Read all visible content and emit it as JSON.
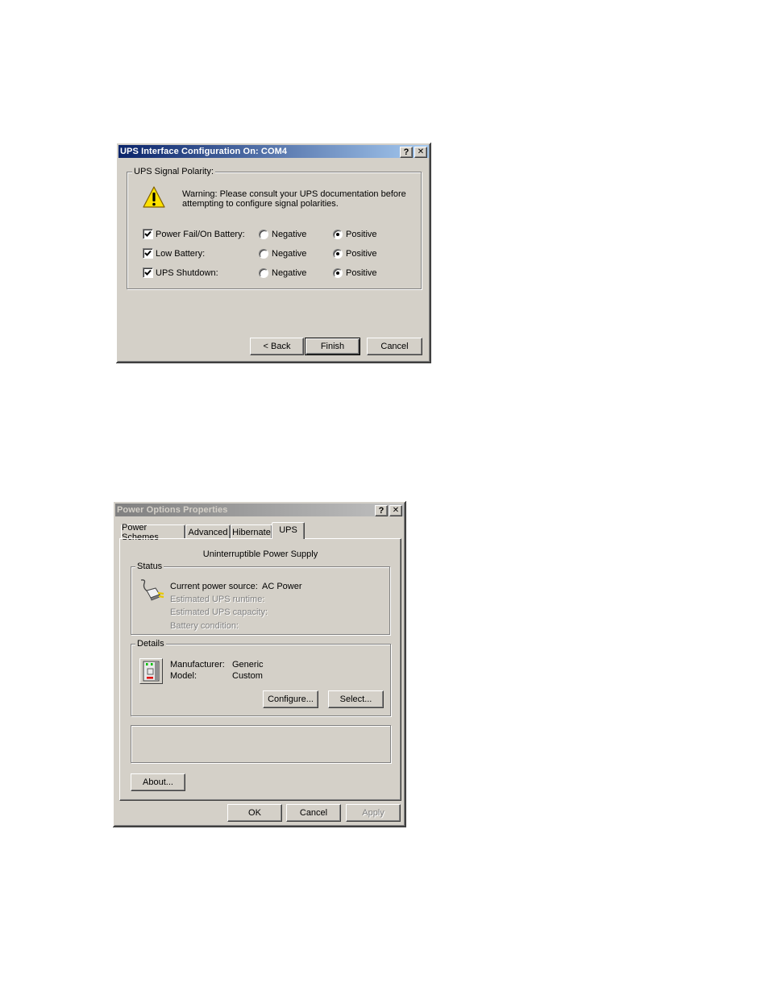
{
  "dialog1": {
    "title": "UPS Interface Configuration On: COM4",
    "help_icon": "?",
    "close_icon": "✕",
    "group_label": "UPS Signal Polarity:",
    "warning_icon": "warning-triangle",
    "warning_text_line1": "Warning: Please consult your UPS documentation before",
    "warning_text_line2": "attempting to configure signal polarities.",
    "signals": [
      {
        "label": "Power Fail/On Battery:",
        "checked": true,
        "negative_label": "Negative",
        "positive_label": "Positive",
        "selected": "Positive"
      },
      {
        "label": "Low Battery:",
        "checked": true,
        "negative_label": "Negative",
        "positive_label": "Positive",
        "selected": "Positive"
      },
      {
        "label": "UPS Shutdown:",
        "checked": true,
        "negative_label": "Negative",
        "positive_label": "Positive",
        "selected": "Positive"
      }
    ],
    "buttons": {
      "back": "< Back",
      "finish": "Finish",
      "cancel": "Cancel"
    }
  },
  "dialog2": {
    "title": "Power Options Properties",
    "help_icon": "?",
    "close_icon": "✕",
    "tabs": [
      {
        "label": "Power Schemes",
        "selected": false
      },
      {
        "label": "Advanced",
        "selected": false
      },
      {
        "label": "Hibernate",
        "selected": false
      },
      {
        "label": "UPS",
        "selected": true
      }
    ],
    "panel_heading": "Uninterruptible Power Supply",
    "status": {
      "label": "Status",
      "icon": "power-plug",
      "rows": [
        {
          "label": "Current power source:",
          "value": "AC Power",
          "enabled": true
        },
        {
          "label": "Estimated UPS runtime:",
          "value": "",
          "enabled": false
        },
        {
          "label": "Estimated UPS capacity:",
          "value": "",
          "enabled": false
        },
        {
          "label": "Battery condition:",
          "value": "",
          "enabled": false
        }
      ]
    },
    "details": {
      "label": "Details",
      "icon": "ups-device",
      "manufacturer_label": "Manufacturer:",
      "manufacturer_value": "Generic",
      "model_label": "Model:",
      "model_value": "Custom",
      "configure_button": "Configure...",
      "select_button": "Select..."
    },
    "about_button": "About...",
    "buttons": {
      "ok": "OK",
      "cancel": "Cancel",
      "apply": "Apply",
      "apply_enabled": false
    }
  }
}
